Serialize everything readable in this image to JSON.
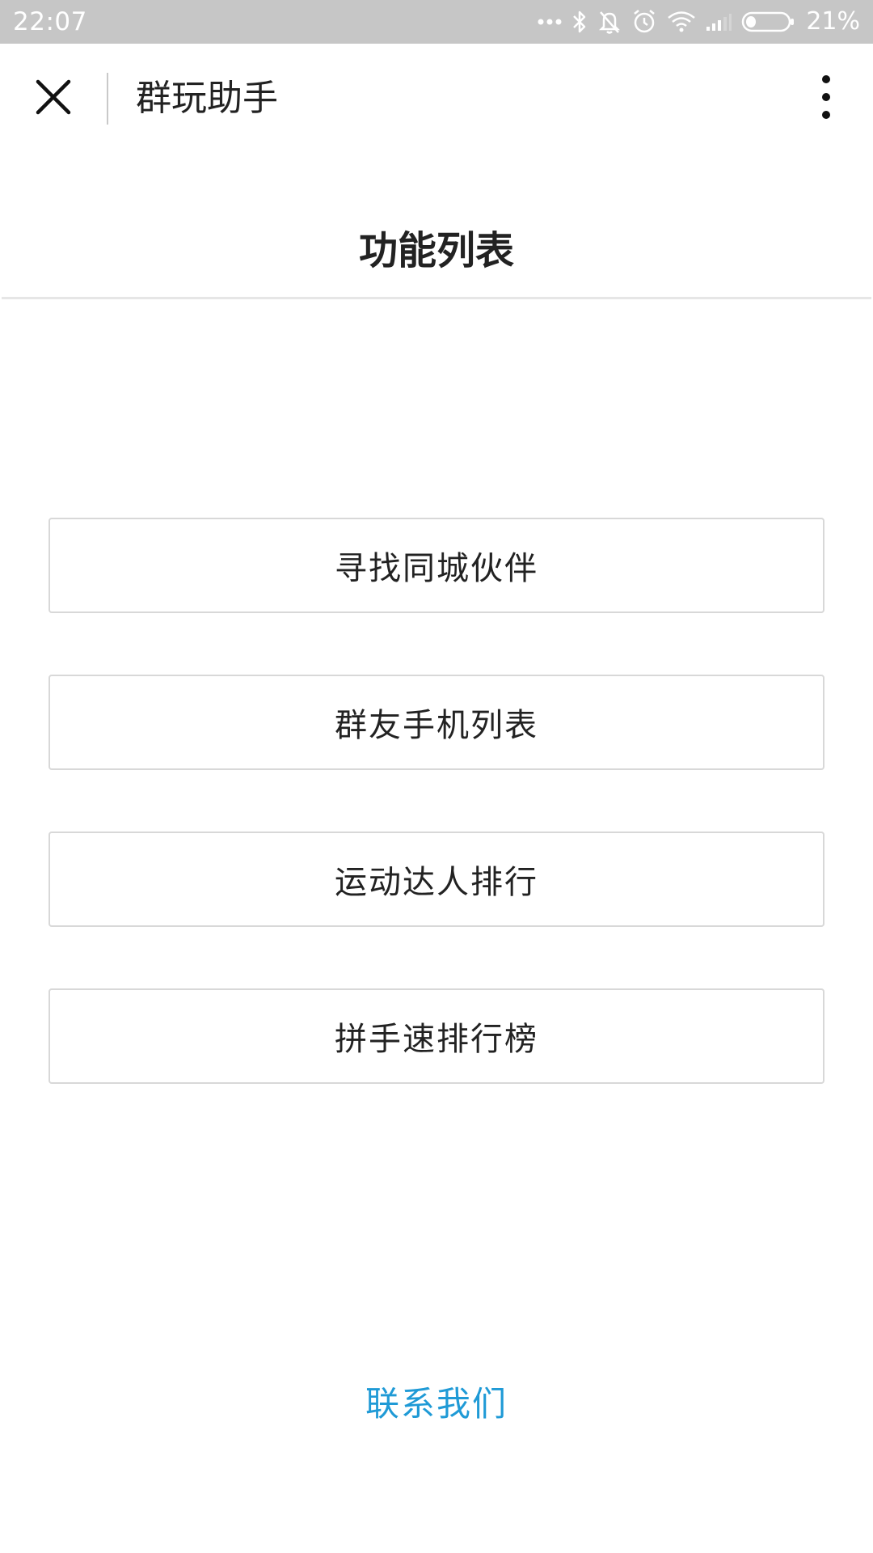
{
  "status_bar": {
    "time": "22:07",
    "battery_percent": "21%",
    "icons": [
      "more-dots-icon",
      "bluetooth-icon",
      "bell-muted-icon",
      "alarm-icon",
      "wifi-icon",
      "signal-icon",
      "battery-icon"
    ]
  },
  "nav": {
    "title": "群玩助手",
    "close_icon": "close-icon",
    "more_icon": "more-vertical-icon"
  },
  "page": {
    "title": "功能列表"
  },
  "menu": {
    "items": [
      {
        "label": "寻找同城伙伴"
      },
      {
        "label": "群友手机列表"
      },
      {
        "label": "运动达人排行"
      },
      {
        "label": "拼手速排行榜"
      }
    ]
  },
  "footer": {
    "contact_label": "联系我们"
  },
  "colors": {
    "status_bar_bg": "#c6c6c6",
    "link": "#1f9ad6",
    "border": "#d8d8d8",
    "text": "#222222"
  }
}
